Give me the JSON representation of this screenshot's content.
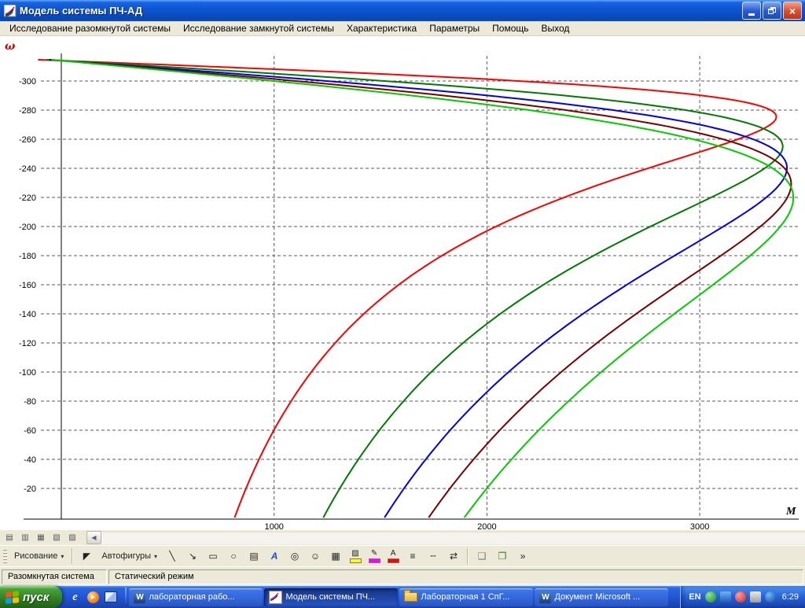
{
  "window": {
    "title": "Модель системы ПЧ-АД"
  },
  "menu": {
    "items": [
      "Исследование разомкнутой системы",
      "Исследование замкнутой системы",
      "Характеристика",
      "Параметры",
      "Помощь",
      "Выход"
    ]
  },
  "chart_data": {
    "type": "line",
    "title": "",
    "xlabel": "M",
    "ylabel": "ω",
    "x_ticks": [
      1000,
      2000,
      3000
    ],
    "y_ticks": [
      -300,
      -280,
      -260,
      -240,
      -220,
      -200,
      -180,
      -160,
      -140,
      -120,
      -100,
      -80,
      -60,
      -40,
      -20
    ],
    "x_range": [
      0,
      3480
    ],
    "y_range": [
      -316,
      0
    ],
    "grid": "dashed",
    "description": "Family of five mechanical characteristics ω(M) of an induction motor fed from a frequency converter (open-loop system); each curve rises from M=0 at synchronous speed ω≈-314, bends at its critical torque near M≈3400, and descends to its starting torque at ω=0",
    "series": [
      {
        "name": "red",
        "color": "#ff0000",
        "omega_sync": -314,
        "M_critical": 3360,
        "s_critical": 0.123,
        "omega_critical": -275,
        "M_start": 814
      },
      {
        "name": "dark-green",
        "color": "#007a00",
        "omega_sync": -314,
        "M_critical": 3390,
        "s_critical": 0.188,
        "omega_critical": -255,
        "M_start": 1243
      },
      {
        "name": "blue",
        "color": "#0000ee",
        "omega_sync": -314,
        "M_critical": 3410,
        "s_critical": 0.235,
        "omega_critical": -240,
        "M_start": 1519
      },
      {
        "name": "dark-red",
        "color": "#7a0000",
        "omega_sync": -314,
        "M_critical": 3430,
        "s_critical": 0.27,
        "omega_critical": -229,
        "M_start": 1726
      },
      {
        "name": "bright-green",
        "color": "#00cc00",
        "omega_sync": -314,
        "M_critical": 3440,
        "s_critical": 0.3,
        "omega_critical": -220,
        "M_start": 1894
      }
    ]
  },
  "view_strip": {
    "view_buttons": [
      "▤",
      "▥",
      "▦",
      "▧",
      "▨"
    ],
    "scroll_left": "◀"
  },
  "drawing_toolbar": {
    "draw_label": "Рисование",
    "autoshapes_label": "Автофигуры",
    "caret": "▾",
    "icons": {
      "select": "◤",
      "line": "╲",
      "arrow": "↘",
      "rectangle": "▭",
      "oval": "○",
      "textbox": "▤",
      "wordart": "А",
      "diagram": "◎",
      "clipart": "☺",
      "picture": "▦",
      "fill": "▨",
      "line_color": "✎",
      "font_color": "А",
      "line_style": "≡",
      "dash_style": "╌",
      "arrow_style": "⇄",
      "shadow": "❑",
      "threed": "❒",
      "overflow": "»"
    },
    "colors": {
      "fill_bar": "#ffff00",
      "line_bar": "#ff00ff",
      "font_bar": "#ff0000"
    }
  },
  "status_bar": {
    "left": "Разомкнутая система",
    "right": "Статический режим"
  },
  "taskbar": {
    "start_label": "пуск",
    "icons": {
      "word": "W",
      "ie": "e",
      "media_play": "▶"
    },
    "tasks": [
      {
        "label": "лабораторная рабо...",
        "icon": "word",
        "active": false
      },
      {
        "label": "Модель системы ПЧ...",
        "icon": "model-app",
        "active": true
      },
      {
        "label": "Лабораторная 1 СпГ...",
        "icon": "folder",
        "active": false
      },
      {
        "label": "Документ Microsoft ...",
        "icon": "word",
        "active": false
      }
    ],
    "language": "EN",
    "clock": "6:29"
  }
}
